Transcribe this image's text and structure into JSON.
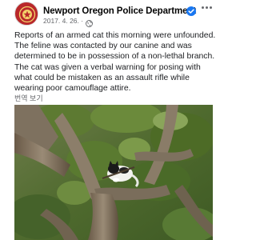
{
  "post": {
    "page_name": "Newport Oregon Police Department",
    "date": "2017. 4. 26.",
    "separator": "·",
    "body_lines": [
      "Reports of an armed cat this morning were unfounded.",
      "The feline was contacted by our canine and was",
      "determined to be in possession of a non-lethal branch.",
      "The cat was given a verbal warning for posing with",
      "what could be mistaken as an assault rifle while",
      "wearing poor camouflage attire."
    ],
    "translate_label": "번역 보기"
  },
  "colors": {
    "verified_badge": "#1877f2",
    "avatar_badge": "#b9282a",
    "meta_text": "#65676b"
  },
  "icons": {
    "avatar": "police-badge-icon",
    "verified": "verified-check-icon",
    "audience": "globe-icon",
    "menu": "more-dots-icon"
  }
}
